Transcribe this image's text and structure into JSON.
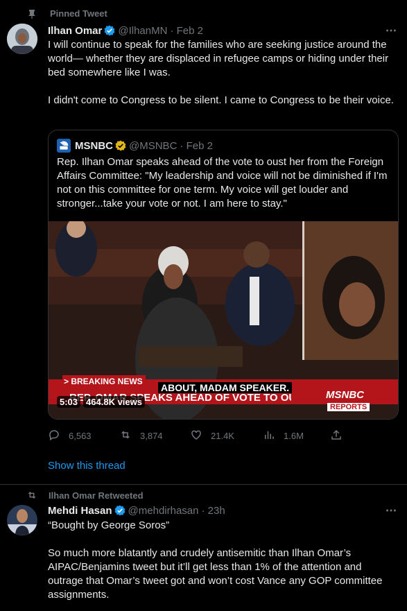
{
  "pinned_label": "Pinned Tweet",
  "tweet1": {
    "name": "Ilhan Omar",
    "handle": "@IlhanMN",
    "date": "· Feb 2",
    "paragraphs": [
      "I will continue to speak for the families who are seeking justice around the world— whether they are displaced in refugee camps or hiding under their bed somewhere like I was.",
      "I didn't come to Congress to be silent. I came to Congress to be their voice."
    ],
    "quote": {
      "name": "MSNBC",
      "handle": "@MSNBC",
      "date": "· Feb 2",
      "text": "Rep. Ilhan Omar speaks ahead of the vote to oust her from the Foreign Affairs Committee: \"My leadership and voice will not be diminished if I'm not on this committee for one term. My voice will get louder and stronger...take your vote or not. I am here to stay.\"",
      "video": {
        "breaking": "> BREAKING NEWS",
        "caption": "ABOUT, MADAM SPEAKER.",
        "chyron": "REP. OMAR SPEAKS AHEAD OF VOTE TO OUST FROM",
        "duration": "5:03",
        "views": "464.8K views",
        "brand_top": "MSNBC",
        "brand_bottom": "REPORTS"
      }
    },
    "actions": {
      "replies": "6,563",
      "retweets": "3,874",
      "likes": "21.4K",
      "views": "1.6M"
    },
    "show_thread": "Show this thread"
  },
  "retweeted_label": "Ilhan Omar Retweeted",
  "tweet2": {
    "name": "Mehdi Hasan",
    "handle": "@mehdirhasan",
    "date": "· 23h",
    "paragraphs": [
      "“Bought by George Soros”",
      "So much more blatantly and crudely antisemitic than Ilhan Omar’s AIPAC/Benjamins tweet but it’ll get less than 1% of the attention and outrage that Omar’s tweet got and won’t cost Vance any GOP committee assignments."
    ]
  },
  "colors": {
    "background": "#000000",
    "text": "#e7e9ea",
    "muted": "#71767b",
    "link": "#1d9bf0",
    "verified_blue": "#1d9bf0",
    "verified_gold": "#e2b719",
    "divider": "#2f3336"
  }
}
